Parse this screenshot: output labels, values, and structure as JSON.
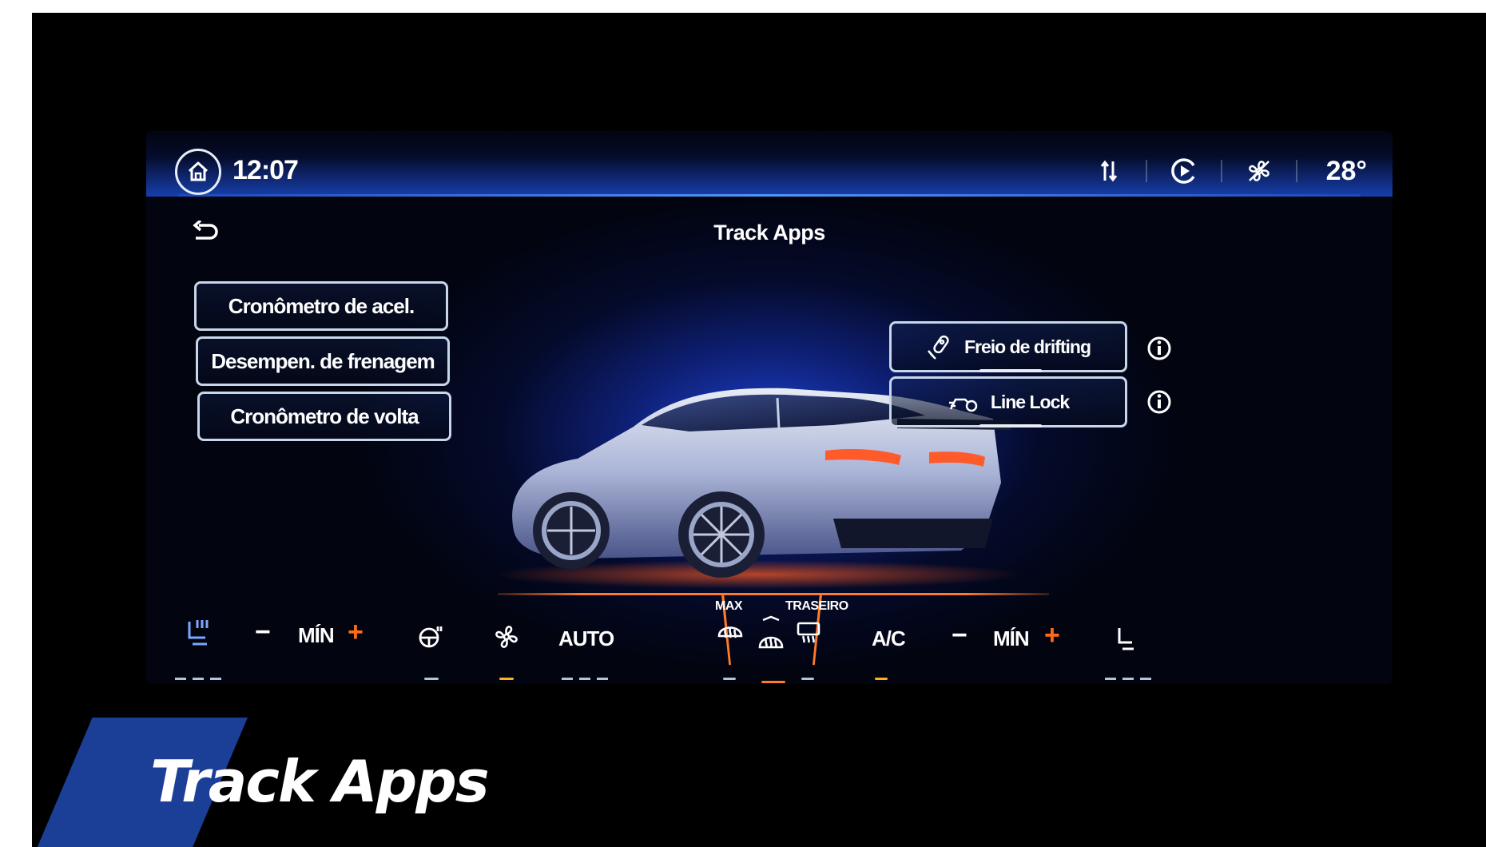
{
  "status_bar": {
    "time": "12:07",
    "temperature": "28°",
    "icons": [
      "home-icon",
      "sort-icon",
      "play-circle-icon",
      "fan-off-icon"
    ]
  },
  "page": {
    "title": "Track Apps",
    "back_icon": "back-icon"
  },
  "menu": [
    {
      "label": "Cronômetro de acel."
    },
    {
      "label": "Desempen. de frenagem"
    },
    {
      "label": "Cronômetro de volta"
    }
  ],
  "side_controls": [
    {
      "label": "Freio de drifting",
      "icon": "drift-brake-icon"
    },
    {
      "label": "Line Lock",
      "icon": "line-lock-icon"
    }
  ],
  "climate": {
    "left_temp": "MÍN",
    "right_temp": "MÍN",
    "auto_label": "AUTO",
    "max_label": "MAX",
    "rear_label": "TRASEIRO",
    "ac_label": "A/C",
    "minus": "−",
    "plus": "+"
  },
  "banner": {
    "title": "Track Apps"
  },
  "colors": {
    "accent": "#ff7a2a",
    "screen_glow": "#1e46dc",
    "banner_blue": "#1b3f96"
  }
}
